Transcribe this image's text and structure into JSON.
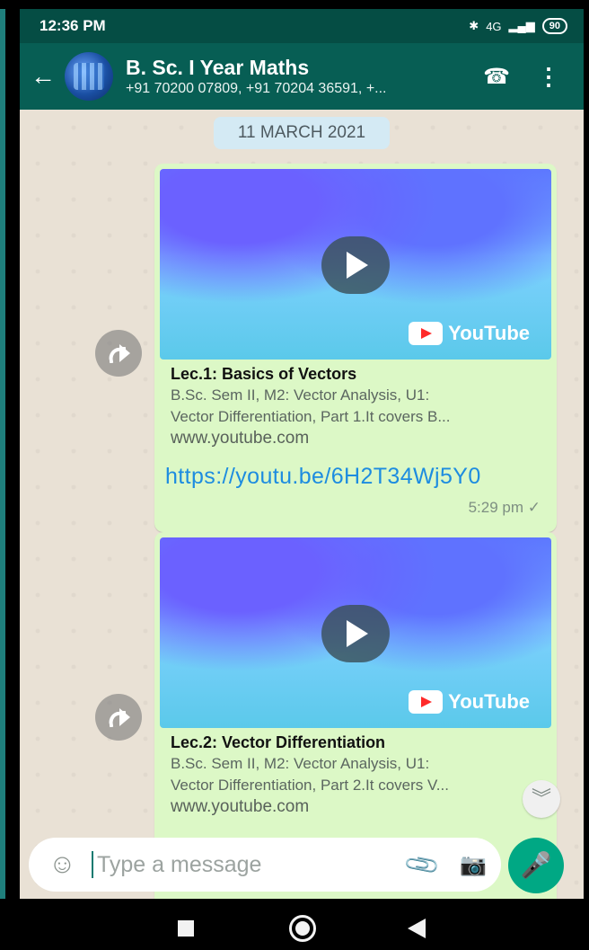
{
  "status": {
    "time": "12:36 PM",
    "network": "4G",
    "battery": "90"
  },
  "chat": {
    "title": "B. Sc. I Year Maths",
    "participants": "+91 70200 07809, +91 70204 36591, +..."
  },
  "date_chip": "11 MARCH 2021",
  "messages": [
    {
      "lecture_title": "Lec.1: Basics of Vectors",
      "description_line1": "B.Sc. Sem II, M2: Vector Analysis, U1:",
      "description_line2": "Vector Differentiation, Part 1.It covers B...",
      "domain": "www.youtube.com",
      "link": "https://youtu.be/6H2T34Wj5Y0",
      "time": "5:29 pm",
      "status": "✓",
      "brand": "YouTube"
    },
    {
      "lecture_title": "Lec.2: Vector Differentiation",
      "description_line1": "B.Sc. Sem II, M2: Vector Analysis, U1:",
      "description_line2": "Vector Differentiation, Part 2.It covers V...",
      "domain": "www.youtube.com",
      "brand": "YouTube"
    }
  ],
  "composer": {
    "placeholder": "Type a message"
  },
  "icons": {
    "back": "back-arrow-icon",
    "call": "add-call-icon",
    "menu": "more-vert-icon",
    "forward": "forward-icon",
    "emoji": "emoji-icon",
    "attach": "paperclip-icon",
    "camera": "camera-icon",
    "mic": "microphone-icon",
    "scroll": "double-chevron-down-icon"
  },
  "colors": {
    "header": "#075e54",
    "bubble": "#dcf8c6",
    "link": "#1d8ce0",
    "mic": "#00a884"
  }
}
